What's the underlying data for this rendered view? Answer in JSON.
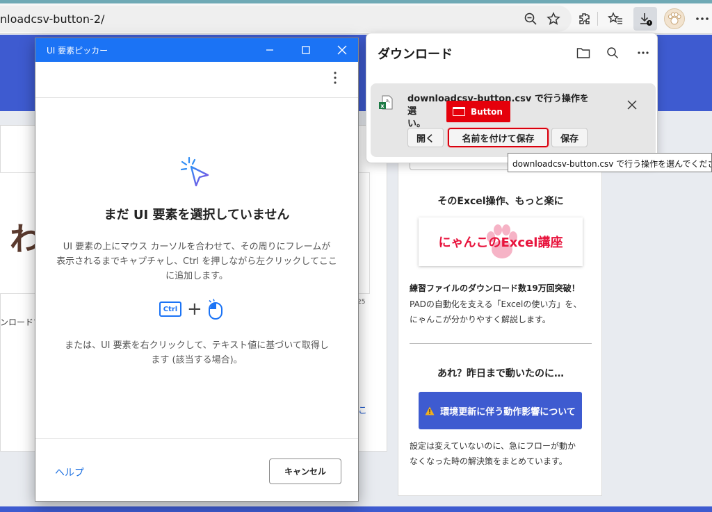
{
  "browser": {
    "url": "nloadcsv-button-2/",
    "icons": [
      "zoom-out-icon",
      "favorite-star-icon",
      "extensions-icon",
      "favorites-list-icon",
      "download-icon",
      "profile-avatar-icon",
      "more-icon"
    ]
  },
  "page": {
    "big_char": "わ",
    "small_num": "25",
    "left_text_fragment": "ンロードす",
    "link_fragment": "こ",
    "sidebar": {
      "heading1": "そのExcel操作、もっと楽に",
      "banner_text": "にゃんこのExcel講座",
      "bold_line": "練習ファイルのダウンロード数19万回突破！",
      "desc1_line1": "PADの自動化を支える「Excelの使い方」を、",
      "desc1_line2": "にゃんこが分かりやすく解説します。",
      "heading2": "あれ？昨日まで動いたのに…",
      "button_label": "環境更新に伴う動作影響について",
      "desc2_line1": "設定は変えていないのに、急にフローが動か",
      "desc2_line2": "なくなった時の解決策をまとめています。"
    }
  },
  "picker": {
    "title": "UI 要素ピッカー",
    "heading": "まだ UI 要素を選択していません",
    "desc_line1": "UI 要素の上にマウス カーソルを合わせて、その周りにフレームが",
    "desc_line2": "表示されるまでキャプチャし、Ctrl を押しながら左クリックしてここ",
    "desc_line3": "に追加します。",
    "ctrl_key": "Ctrl",
    "plus": "+",
    "desc2_line1": "または、UI 要素を右クリックして、テキスト値に基づいて取得し",
    "desc2_line2": "ます (該当する場合)。",
    "help": "ヘルプ",
    "cancel": "キャンセル"
  },
  "downloads": {
    "title": "ダウンロード",
    "message_line1": "downloadcsv-button.csv で行う操作を選",
    "message_line2": "い。",
    "open": "開く",
    "save_as": "名前を付けて保存",
    "save": "保存"
  },
  "ui_tag": {
    "label": "Button"
  },
  "tooltip": {
    "text": "downloadcsv-button.csv で行う操作を選んでください。"
  },
  "colors": {
    "accent_blue": "#1b73f5",
    "page_blue": "#3e5bd0",
    "highlight_red": "#e5000b"
  }
}
